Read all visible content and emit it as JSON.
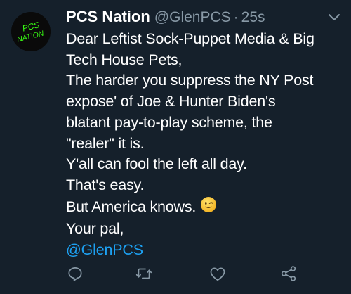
{
  "tweet": {
    "display_name": "PCS Nation",
    "handle": "@GlenPCS",
    "separator": "·",
    "time": "25s",
    "avatar_text_top": "PCS",
    "avatar_text_bottom": "NATION",
    "lines": [
      "Dear Leftist Sock-Puppet Media & Big",
      "Tech House Pets,",
      "The harder you suppress the NY Post",
      "expose' of Joe & Hunter Biden's",
      "blatant pay-to-play scheme, the",
      "\"realer\" it is.",
      "Y'all can fool the left all day.",
      "That's easy.",
      "But America knows.",
      "Your pal,"
    ],
    "mention": "@GlenPCS",
    "emoji": "winking-face"
  },
  "icons": {
    "more": "chevron-down-icon",
    "reply": "reply-icon",
    "retweet": "retweet-icon",
    "like": "like-icon",
    "share": "share-icon"
  },
  "colors": {
    "background": "#15202b",
    "text": "#ffffff",
    "secondary": "#8899a6",
    "link": "#1da1f2",
    "avatar_text": "#39ff14"
  }
}
